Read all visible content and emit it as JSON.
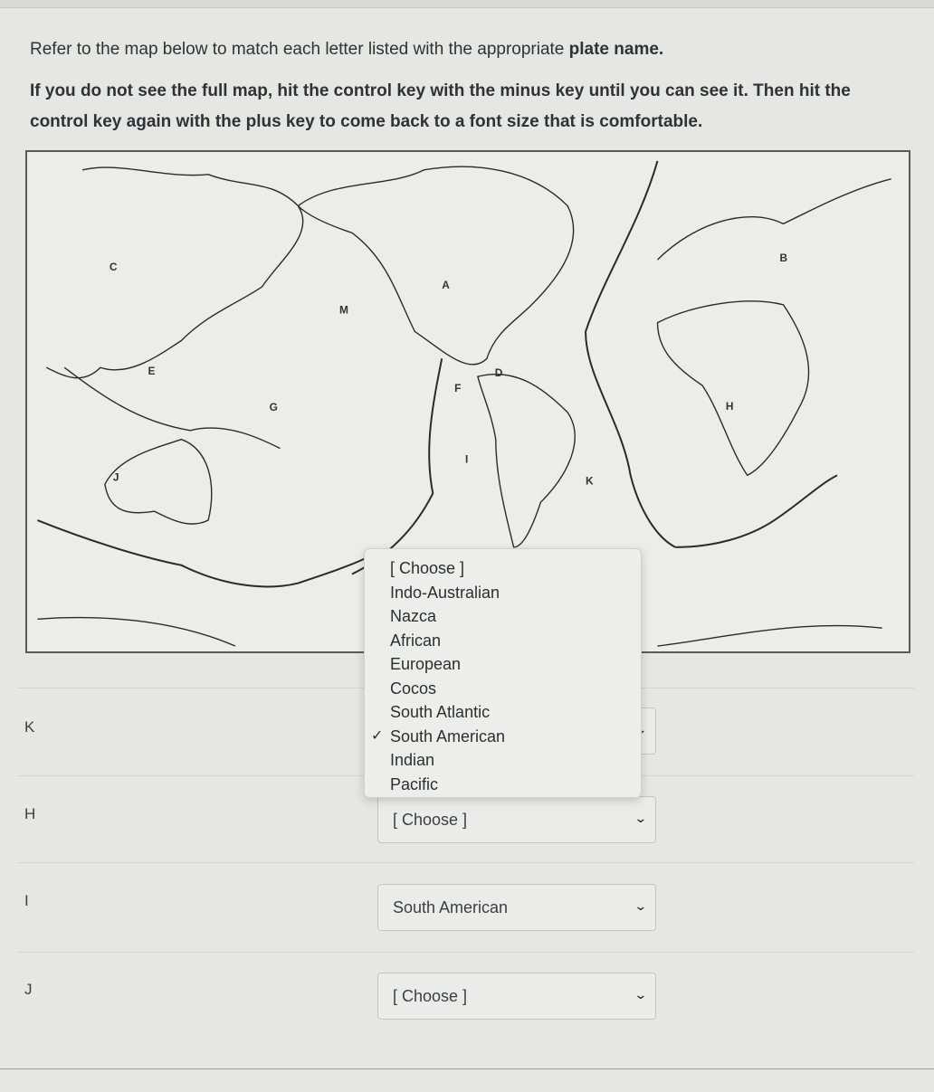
{
  "question": {
    "line1_prefix": "Refer to the map below to match each letter listed with the appropriate ",
    "line1_bold": "plate name.",
    "line2": "If you do not see the full map, hit the control key with the minus key until you can see it.  Then hit the control key again with the plus key to come back to a font size that is comfortable."
  },
  "map": {
    "alt": "World map of tectonic plates with lettered plates",
    "labels": [
      "C",
      "A",
      "M",
      "E",
      "F",
      "D",
      "G",
      "I",
      "J",
      "K",
      "B",
      "H"
    ]
  },
  "rows": [
    {
      "letter": "K",
      "selected": "South American",
      "expanded": true
    },
    {
      "letter": "H",
      "selected": "[ Choose ]",
      "expanded": false
    },
    {
      "letter": "I",
      "selected": "South American",
      "expanded": false
    },
    {
      "letter": "J",
      "selected": "[ Choose ]",
      "expanded": false
    }
  ],
  "dropdown": {
    "options": [
      "[ Choose ]",
      "Indo-Australian",
      "Nazca",
      "African",
      "European",
      "Cocos",
      "South Atlantic",
      "South American",
      "Indian",
      "Pacific"
    ],
    "checked_index": 7,
    "check_glyph": "✓"
  },
  "icons": {
    "chevron": "⌄"
  }
}
